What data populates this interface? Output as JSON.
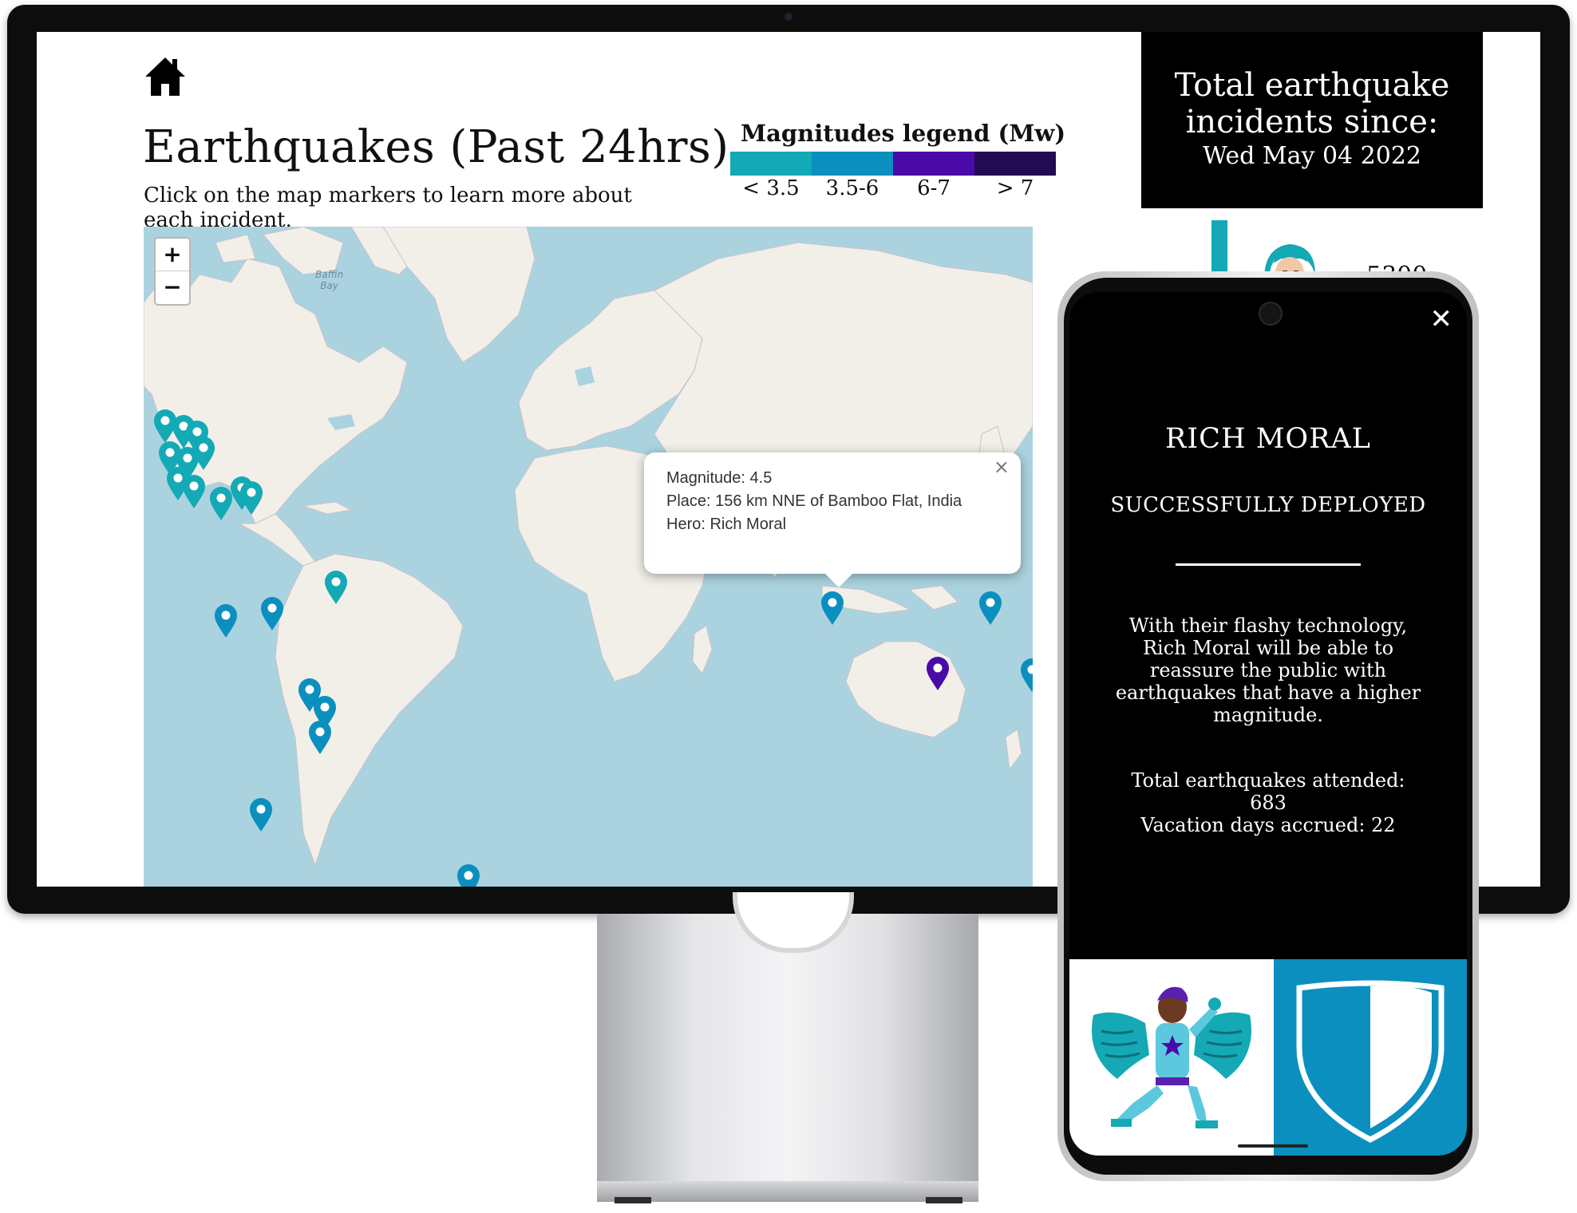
{
  "page": {
    "title": "Earthquakes (Past 24hrs)",
    "subtitle": "Click on the map markers to learn more about each incident."
  },
  "legend": {
    "title": "Magnitudes legend (Mw)",
    "items": [
      {
        "label": "< 3.5",
        "color": "#13aab6"
      },
      {
        "label": "3.5-6",
        "color": "#0b8fbf"
      },
      {
        "label": "6-7",
        "color": "#4a0aa8"
      },
      {
        "label": "> 7",
        "color": "#240a52"
      }
    ]
  },
  "counter": {
    "line1": "Total earthquake",
    "line2": "incidents since:",
    "date": "Wed May 04 2022",
    "value": "5300"
  },
  "map": {
    "zoom_in": "+",
    "zoom_out": "−",
    "bay_label_1": "Baffin",
    "bay_label_2": "Bay",
    "icons": {
      "zoom_in": "plus-icon",
      "zoom_out": "minus-icon",
      "marker": "map-marker-icon"
    },
    "colors": {
      "water": "#aad3df",
      "land": "#f2efe9"
    }
  },
  "popup": {
    "magnitude": "Magnitude: 4.5",
    "place": "Place: 156 km NNE of Bamboo Flat, India",
    "hero": "Hero: Rich Moral",
    "close": "×"
  },
  "phone": {
    "close": "✕",
    "hero_name": "RICH MORAL",
    "status": "SUCCESSFULLY DEPLOYED",
    "description": "With their flashy technology, Rich Moral will be able to reassure the public with earthquakes that have a higher magnitude.",
    "total_label": "Total earthquakes attended:",
    "total_value": "683",
    "vacation": "Vacation days accrued: 22"
  }
}
